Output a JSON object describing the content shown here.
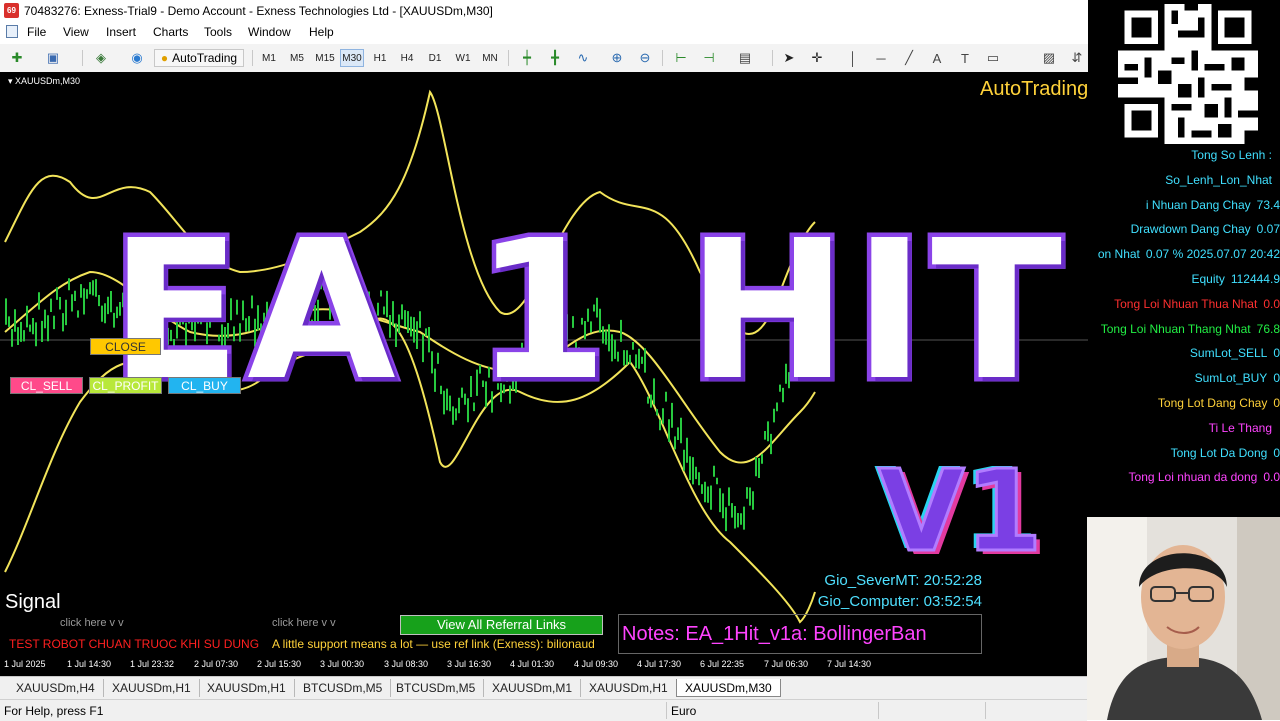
{
  "window": {
    "app_badge": "69",
    "title": "70483276: Exness-Trial9 - Demo Account - Exness Technologies Ltd - [XAUUSDm,M30]"
  },
  "menu": [
    "File",
    "View",
    "Insert",
    "Charts",
    "Tools",
    "Window",
    "Help"
  ],
  "toolbar": {
    "autotrading_label": "AutoTrading",
    "timeframes": [
      "M1",
      "M5",
      "M15",
      "M30",
      "H1",
      "H4",
      "D1",
      "W1",
      "MN"
    ],
    "active_timeframe": "M30"
  },
  "chart": {
    "symbol_label": "XAUUSDm,M30",
    "autotrading_label": "AutoTrading",
    "overlay_title": "EA 1 HIT",
    "overlay_version": "V1",
    "buttons": {
      "close": "CLOSE",
      "cl_sell": "CL_SELL",
      "cl_profit": "CL_PROFIT",
      "cl_buy": "CL_BUY"
    },
    "signal_label": "Signal",
    "click_here": "click here v v",
    "test_robot": "TEST ROBOT CHUAN TRUOC KHI SU DUNG",
    "support_text": "A little support means a lot — use ref link (Exness): bilionaud",
    "referral_button": "View All Referral Links",
    "notes": "Notes: EA_1Hit_v1a: BollingerBan",
    "gio_server": "Gio_SeverMT: 20:52:28",
    "gio_computer": "Gio_Computer: 03:52:54",
    "time_labels": [
      "1 Jul 2025",
      "1 Jul 14:30",
      "1 Jul 23:32",
      "2 Jul 07:30",
      "2 Jul 15:30",
      "3 Jul 00:30",
      "3 Jul 08:30",
      "3 Jul 16:30",
      "4 Jul 01:30",
      "4 Jul 09:30",
      "4 Jul 17:30",
      "6 Jul 22:35",
      "7 Jul 06:30",
      "7 Jul 14:30"
    ],
    "colors": {
      "background": "#000000",
      "bands": "#f2e45a",
      "candles": "#27c93f",
      "close_btn": "#ffc800",
      "cl_sell_btn": "#ff4a8a",
      "cl_profit_btn": "#b8e83a",
      "cl_buy_btn": "#22b4f0"
    }
  },
  "info_panel": [
    {
      "label": "Tong So Lenh :",
      "color": "#40e0ff"
    },
    {
      "label": "So_Lenh_Lon_Nhat",
      "color": "#40e0ff"
    },
    {
      "label": "i Nhuan Dang Chay",
      "value": "73.4",
      "color": "#40e0ff"
    },
    {
      "label": "Drawdown Dang Chay",
      "value": "0.07",
      "color": "#40e0ff"
    },
    {
      "label": "on Nhat",
      "value": "0.07 % 2025.07.07 20:42",
      "color": "#40e0ff"
    },
    {
      "label": "Equity",
      "value": "112444.9",
      "color": "#40e0ff"
    },
    {
      "label": "Tong Loi Nhuan Thua Nhat",
      "value": "0.0",
      "color": "#ff3030"
    },
    {
      "label": "Tong Loi Nhuan Thang Nhat",
      "value": "76.8",
      "color": "#22ee44"
    },
    {
      "label": "SumLot_SELL",
      "value": "0",
      "color": "#40e0ff"
    },
    {
      "label": "SumLot_BUY",
      "value": "0",
      "color": "#40e0ff"
    },
    {
      "label": "Tong Lot Dang Chay",
      "value": "0",
      "color": "#ffd23a"
    },
    {
      "label": "Ti Le Thang",
      "color": "#ff44ff"
    },
    {
      "label": "Tong Lot Da Dong",
      "value": "0",
      "color": "#40e0ff"
    },
    {
      "label": "Tong Loi nhuan da dong",
      "value": "0.0",
      "color": "#ff44ff"
    }
  ],
  "tabs": [
    "XAUUSDm,H4",
    "XAUUSDm,H1",
    "XAUUSDm,H1",
    "BTCUSDm,M5",
    "BTCUSDm,M5",
    "XAUUSDm,M1",
    "XAUUSDm,H1",
    "XAUUSDm,M30"
  ],
  "active_tab": "XAUUSDm,M30",
  "status": {
    "help": "For Help, press F1",
    "profile": "Euro"
  }
}
